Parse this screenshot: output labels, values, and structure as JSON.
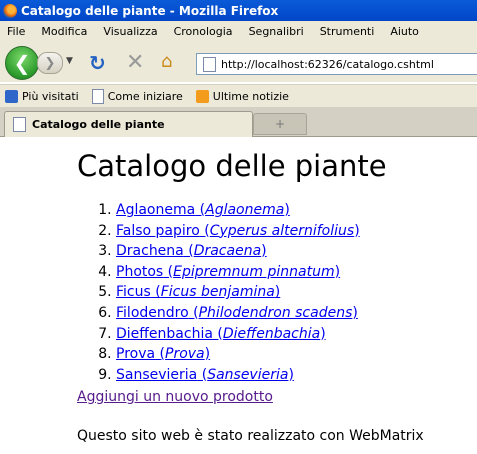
{
  "window": {
    "title": "Catalogo delle piante - Mozilla Firefox"
  },
  "menu": [
    "File",
    "Modifica",
    "Visualizza",
    "Cronologia",
    "Segnalibri",
    "Strumenti",
    "Aiuto"
  ],
  "url": "http://localhost:62326/catalogo.cshtml",
  "bookmarks": [
    "Più visitati",
    "Come iniziare",
    "Ultime notizie"
  ],
  "tab": {
    "title": "Catalogo delle piante",
    "new_tab_symbol": "+"
  },
  "page": {
    "heading": "Catalogo delle piante",
    "plants": [
      {
        "name": "Aglaonema",
        "latin": "Aglaonema"
      },
      {
        "name": "Falso papiro",
        "latin": "Cyperus alternifolius"
      },
      {
        "name": "Drachena",
        "latin": "Dracaena"
      },
      {
        "name": "Photos",
        "latin": "Epipremnum pinnatum"
      },
      {
        "name": "Ficus",
        "latin": "Ficus benjamina"
      },
      {
        "name": "Filodendro",
        "latin": "Philodendron scadens"
      },
      {
        "name": "Dieffenbachia",
        "latin": "Dieffenbachia"
      },
      {
        "name": "Prova",
        "latin": "Prova"
      },
      {
        "name": "Sansevieria",
        "latin": "Sansevieria"
      }
    ],
    "add_link": "Aggiungi un nuovo prodotto",
    "footer": "Questo sito web è stato realizzato con WebMatrix"
  }
}
